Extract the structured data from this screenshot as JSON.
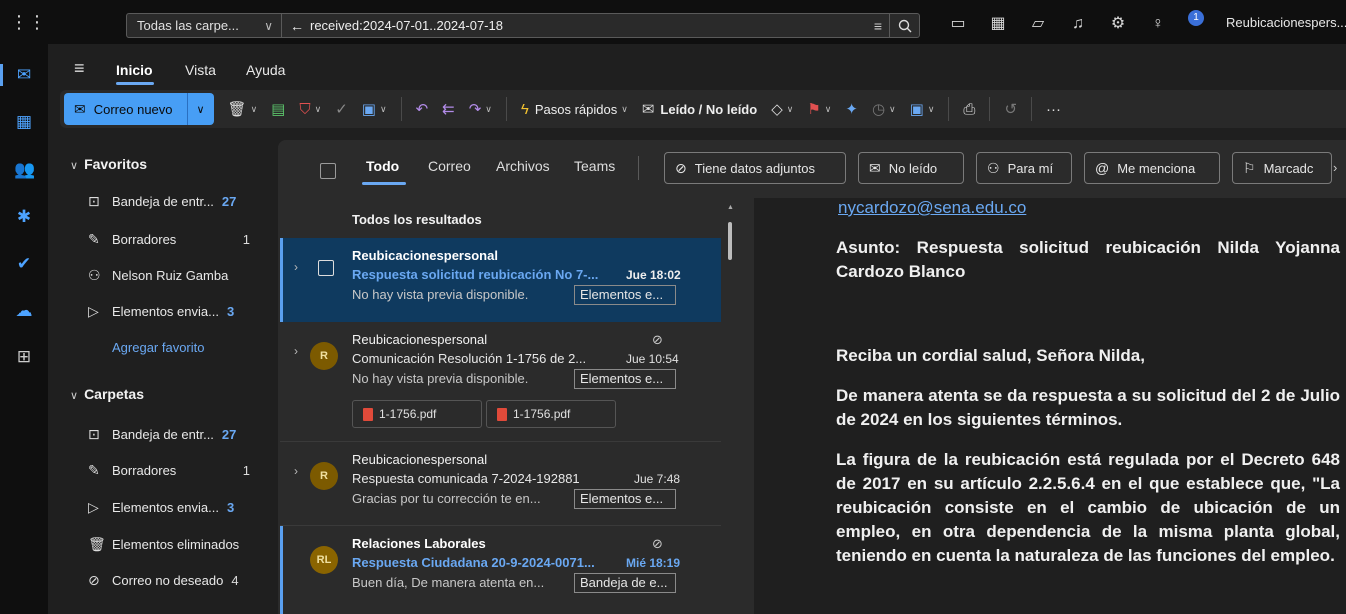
{
  "topbar": {
    "scope_label": "Todas las carpe...",
    "query": "received:2024-07-01..2024-07-18",
    "notification_count": "1",
    "account_name": "Reubicacionespers..."
  },
  "menu": {
    "tabs": [
      "Inicio",
      "Vista",
      "Ayuda"
    ]
  },
  "ribbon": {
    "new_mail": "Correo nuevo",
    "quick_steps": "Pasos rápidos",
    "read_unread": "Leído / No leído"
  },
  "folders": {
    "favorites_header": "Favoritos",
    "favorites": [
      {
        "label": "Bandeja de entr...",
        "count": "27"
      },
      {
        "label": "Borradores",
        "count": "1"
      },
      {
        "label": "Nelson Ruiz Gamba",
        "count": ""
      },
      {
        "label": "Elementos envia...",
        "count": "3"
      }
    ],
    "add_favorite": "Agregar favorito",
    "folders_header": "Carpetas",
    "folders": [
      {
        "label": "Bandeja de entr...",
        "count": "27"
      },
      {
        "label": "Borradores",
        "count": "1"
      },
      {
        "label": "Elementos envia...",
        "count": "3"
      },
      {
        "label": "Elementos eliminados",
        "count": ""
      },
      {
        "label": "Correo no deseado",
        "count": "4"
      }
    ]
  },
  "filterbar": {
    "tabs": [
      "Todo",
      "Correo",
      "Archivos",
      "Teams"
    ],
    "chips": [
      "Tiene datos adjuntos",
      "No leído",
      "Para mí",
      "Me menciona",
      "Marcadc"
    ]
  },
  "list": {
    "header": "Todos los resultados",
    "messages": [
      {
        "sender": "Reubicacionespersonal",
        "subject": "Respuesta solicitud reubicación No 7-...",
        "time": "Jue 18:02",
        "preview": "No hay vista previa disponible.",
        "folder": "Elementos e..."
      },
      {
        "avatar": "R",
        "sender": "Reubicacionespersonal",
        "subject": "Comunicación Resolución 1-1756 de 2...",
        "time": "Jue 10:54",
        "preview": "No hay vista previa disponible.",
        "folder": "Elementos e...",
        "attachments": [
          "1-1756.pdf",
          "1-1756.pdf"
        ]
      },
      {
        "avatar": "R",
        "sender": "Reubicacionespersonal",
        "subject": "Respuesta comunicada 7-2024-192881",
        "time": "Jue 7:48",
        "preview": "Gracias por tu corrección te en...",
        "folder": "Elementos e..."
      },
      {
        "avatar": "RL",
        "sender": "Relaciones Laborales",
        "subject": "Respuesta Ciudadana 20-9-2024-0071...",
        "time": "Mié 18:19",
        "preview": "Buen día, De manera atenta en...",
        "folder": "Bandeja de e..."
      }
    ]
  },
  "reading": {
    "email": "nycardozo@sena.edu.co",
    "subject": "Asunto: Respuesta solicitud reubicación Nilda Yojanna Cardozo Blanco",
    "greeting": "Reciba un cordial salud, Señora Nilda,",
    "para1": "De manera atenta se da respuesta a su solicitud del 2 de Julio de 2024 en los siguientes términos.",
    "para2": "La figura de la reubicación está regulada por el Decreto 648 de 2017 en su artículo 2.2.5.6.4 en el que establece que, \"La reubicación consiste en el cambio de ubicación de un empleo, en otra dependencia de la misma planta global, teniendo en cuenta la naturaleza de las funciones del empleo."
  },
  "colors": {
    "accent": "#479ef5",
    "selected_row": "#0f3a5f"
  }
}
